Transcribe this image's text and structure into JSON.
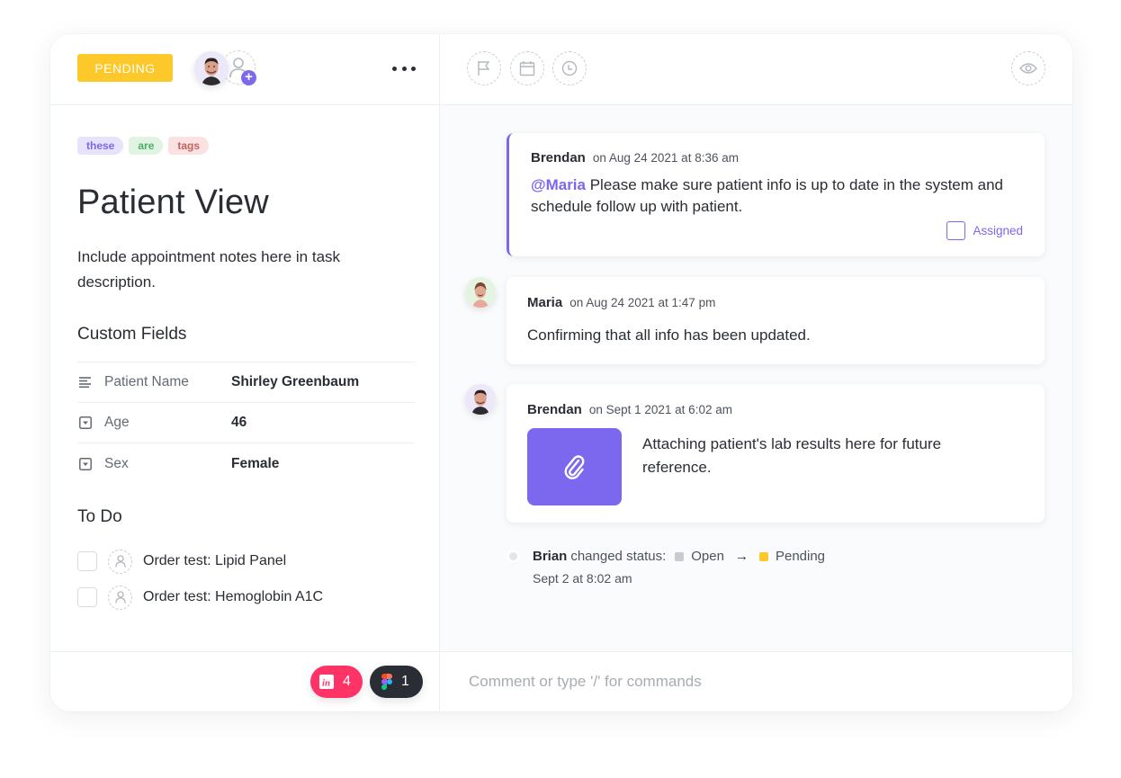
{
  "task": {
    "status": "PENDING",
    "status_color": "#fcc82a",
    "title": "Patient View",
    "description": "Include appointment notes here in task description.",
    "tags": [
      {
        "label": "these",
        "bg": "#e6e3fb",
        "color": "#7b68ee"
      },
      {
        "label": "are",
        "bg": "#e1f3e2",
        "color": "#4caf66"
      },
      {
        "label": "tags",
        "bg": "#fbe1e1",
        "color": "#c0645f"
      }
    ],
    "more_icon": "more-horizontal-icon"
  },
  "custom_fields": {
    "title": "Custom Fields",
    "rows": [
      {
        "icon": "text-lines-icon",
        "label": "Patient Name",
        "value": "Shirley Greenbaum"
      },
      {
        "icon": "dropdown-icon",
        "label": "Age",
        "value": "46"
      },
      {
        "icon": "dropdown-icon",
        "label": "Sex",
        "value": "Female"
      }
    ]
  },
  "todo": {
    "title": "To Do",
    "items": [
      {
        "label": "Order test: Lipid Panel",
        "checked": false
      },
      {
        "label": "Order test: Hemoglobin A1C",
        "checked": false
      }
    ]
  },
  "integrations": [
    {
      "name": "invision",
      "icon": "invision-icon",
      "count": "4",
      "color": "#ff3366"
    },
    {
      "name": "figma",
      "icon": "figma-icon",
      "count": "1",
      "color": "#2a2e34"
    }
  ],
  "toolbar": {
    "icons": [
      "flag-icon",
      "calendar-icon",
      "clock-icon",
      "eye-icon"
    ]
  },
  "comments": [
    {
      "author": "Brendan",
      "time": "on Aug 24 2021 at 8:36 am",
      "mention": "@Maria",
      "body": " Please make sure patient info is up to date in the system and schedule follow up with patient.",
      "action_label": "Assigned"
    },
    {
      "author": "Maria",
      "time": "on Aug 24 2021 at 1:47 pm",
      "body": "Confirming that all info has been updated."
    },
    {
      "author": "Brendan",
      "time": "on Sept 1 2021 at 6:02 am",
      "body": "Attaching patient's lab results here for future reference.",
      "attachment_icon": "paperclip-icon"
    }
  ],
  "activity": {
    "actor": "Brian",
    "action": "changed status:",
    "from": {
      "label": "Open",
      "color": "#c8cbd0"
    },
    "to": {
      "label": "Pending",
      "color": "#fcc82a"
    },
    "time": "Sept 2 at 8:02 am"
  },
  "comment_input": {
    "placeholder": "Comment or type '/' for commands",
    "value": ""
  }
}
